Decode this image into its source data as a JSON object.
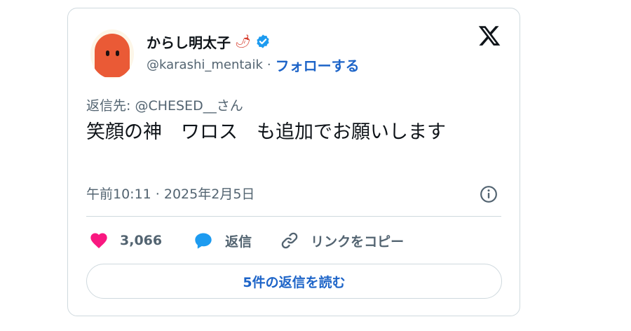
{
  "author": {
    "name": "からし明太子",
    "name_emoji": "🌶",
    "handle": "@karashi_mentaik",
    "separator": "·",
    "follow_label": "フォローする"
  },
  "tweet": {
    "reply_to": "返信先: @CHESED__さん",
    "text": "笑顔の神　ワロス　も追加でお願いします",
    "timestamp": "午前10:11 · 2025年2月5日"
  },
  "actions": {
    "like_count": "3,066",
    "reply_label": "返信",
    "copy_link_label": "リンクをコピー"
  },
  "read_replies_label": "5件の返信を読む",
  "colors": {
    "accent": "#1d64c8",
    "like": "#f91880",
    "reply": "#1d9bf0",
    "avatar": "#ea5a36",
    "verified": "#1d9bf0"
  },
  "icons": [
    "x-logo-icon",
    "verified-badge-icon",
    "info-icon",
    "heart-icon",
    "reply-bubble-icon",
    "link-icon"
  ]
}
